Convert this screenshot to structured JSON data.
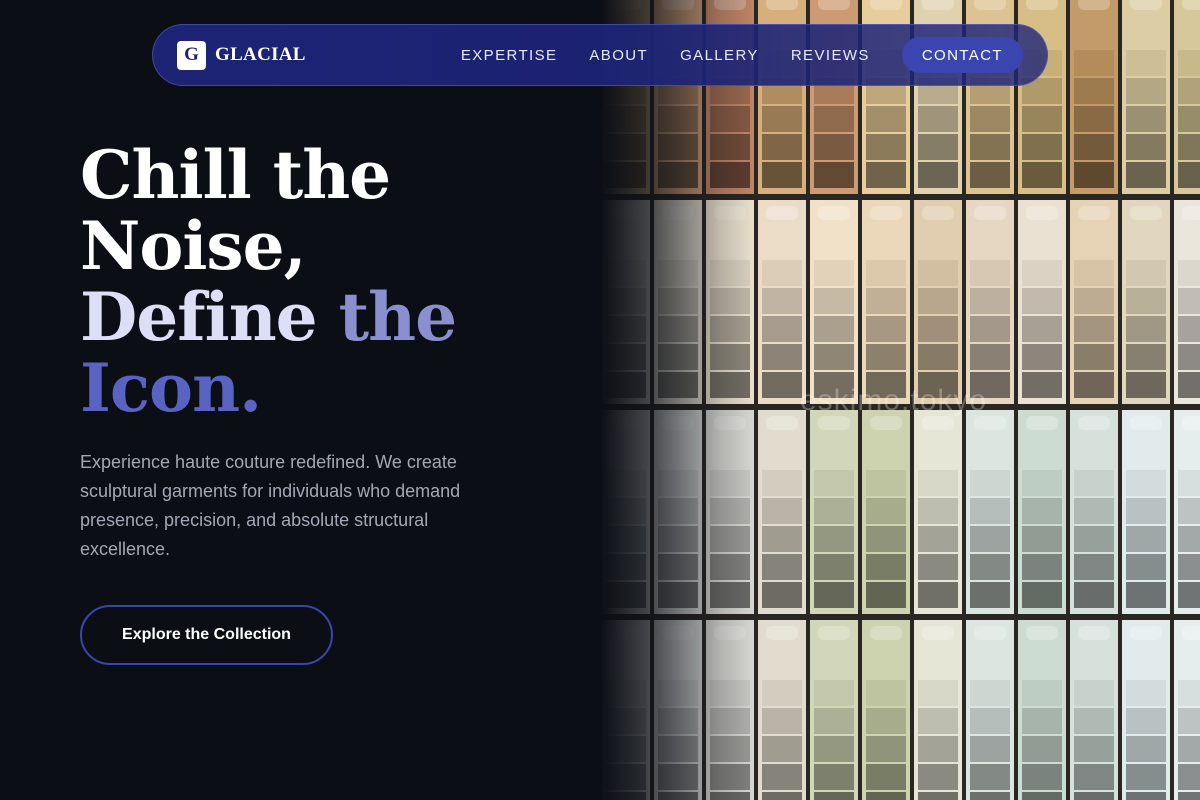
{
  "nav": {
    "logo_letter": "G",
    "brand": "GLACIAL",
    "items": [
      {
        "label": "EXPERTISE"
      },
      {
        "label": "ABOUT"
      },
      {
        "label": "GALLERY"
      },
      {
        "label": "REVIEWS"
      }
    ],
    "contact_label": "CONTACT"
  },
  "hero": {
    "line1": "Chill the",
    "line2": "Noise,",
    "line3_a": "Define",
    "line3_b": "the",
    "line4": "Icon.",
    "description": "Experience haute couture redefined. We create sculptural garments for individuals who demand presence, precision, and absolute structural excellence.",
    "cta_label": "Explore the Collection"
  },
  "image": {
    "watermark": "eskimo.tokyo"
  },
  "colors": {
    "background": "#0b0e14",
    "nav_bg": "#1e257a",
    "accent": "#3b45b0",
    "headline_lavender": "#8a90cf",
    "headline_indigo": "#5863c2"
  }
}
